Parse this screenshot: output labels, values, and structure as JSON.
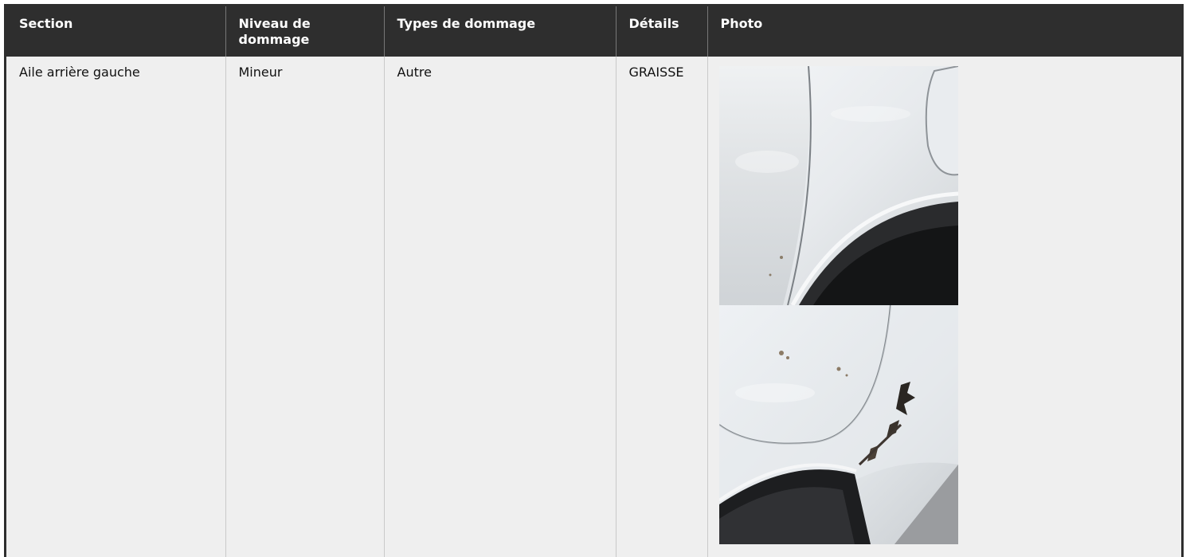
{
  "table": {
    "headers": [
      "Section",
      "Niveau de dommage",
      "Types de dommage",
      "Détails",
      "Photo"
    ],
    "rows": [
      {
        "section": "Aile arrière gauche",
        "niveau": "Mineur",
        "types": "Autre",
        "details": "GRAISSE"
      }
    ]
  }
}
